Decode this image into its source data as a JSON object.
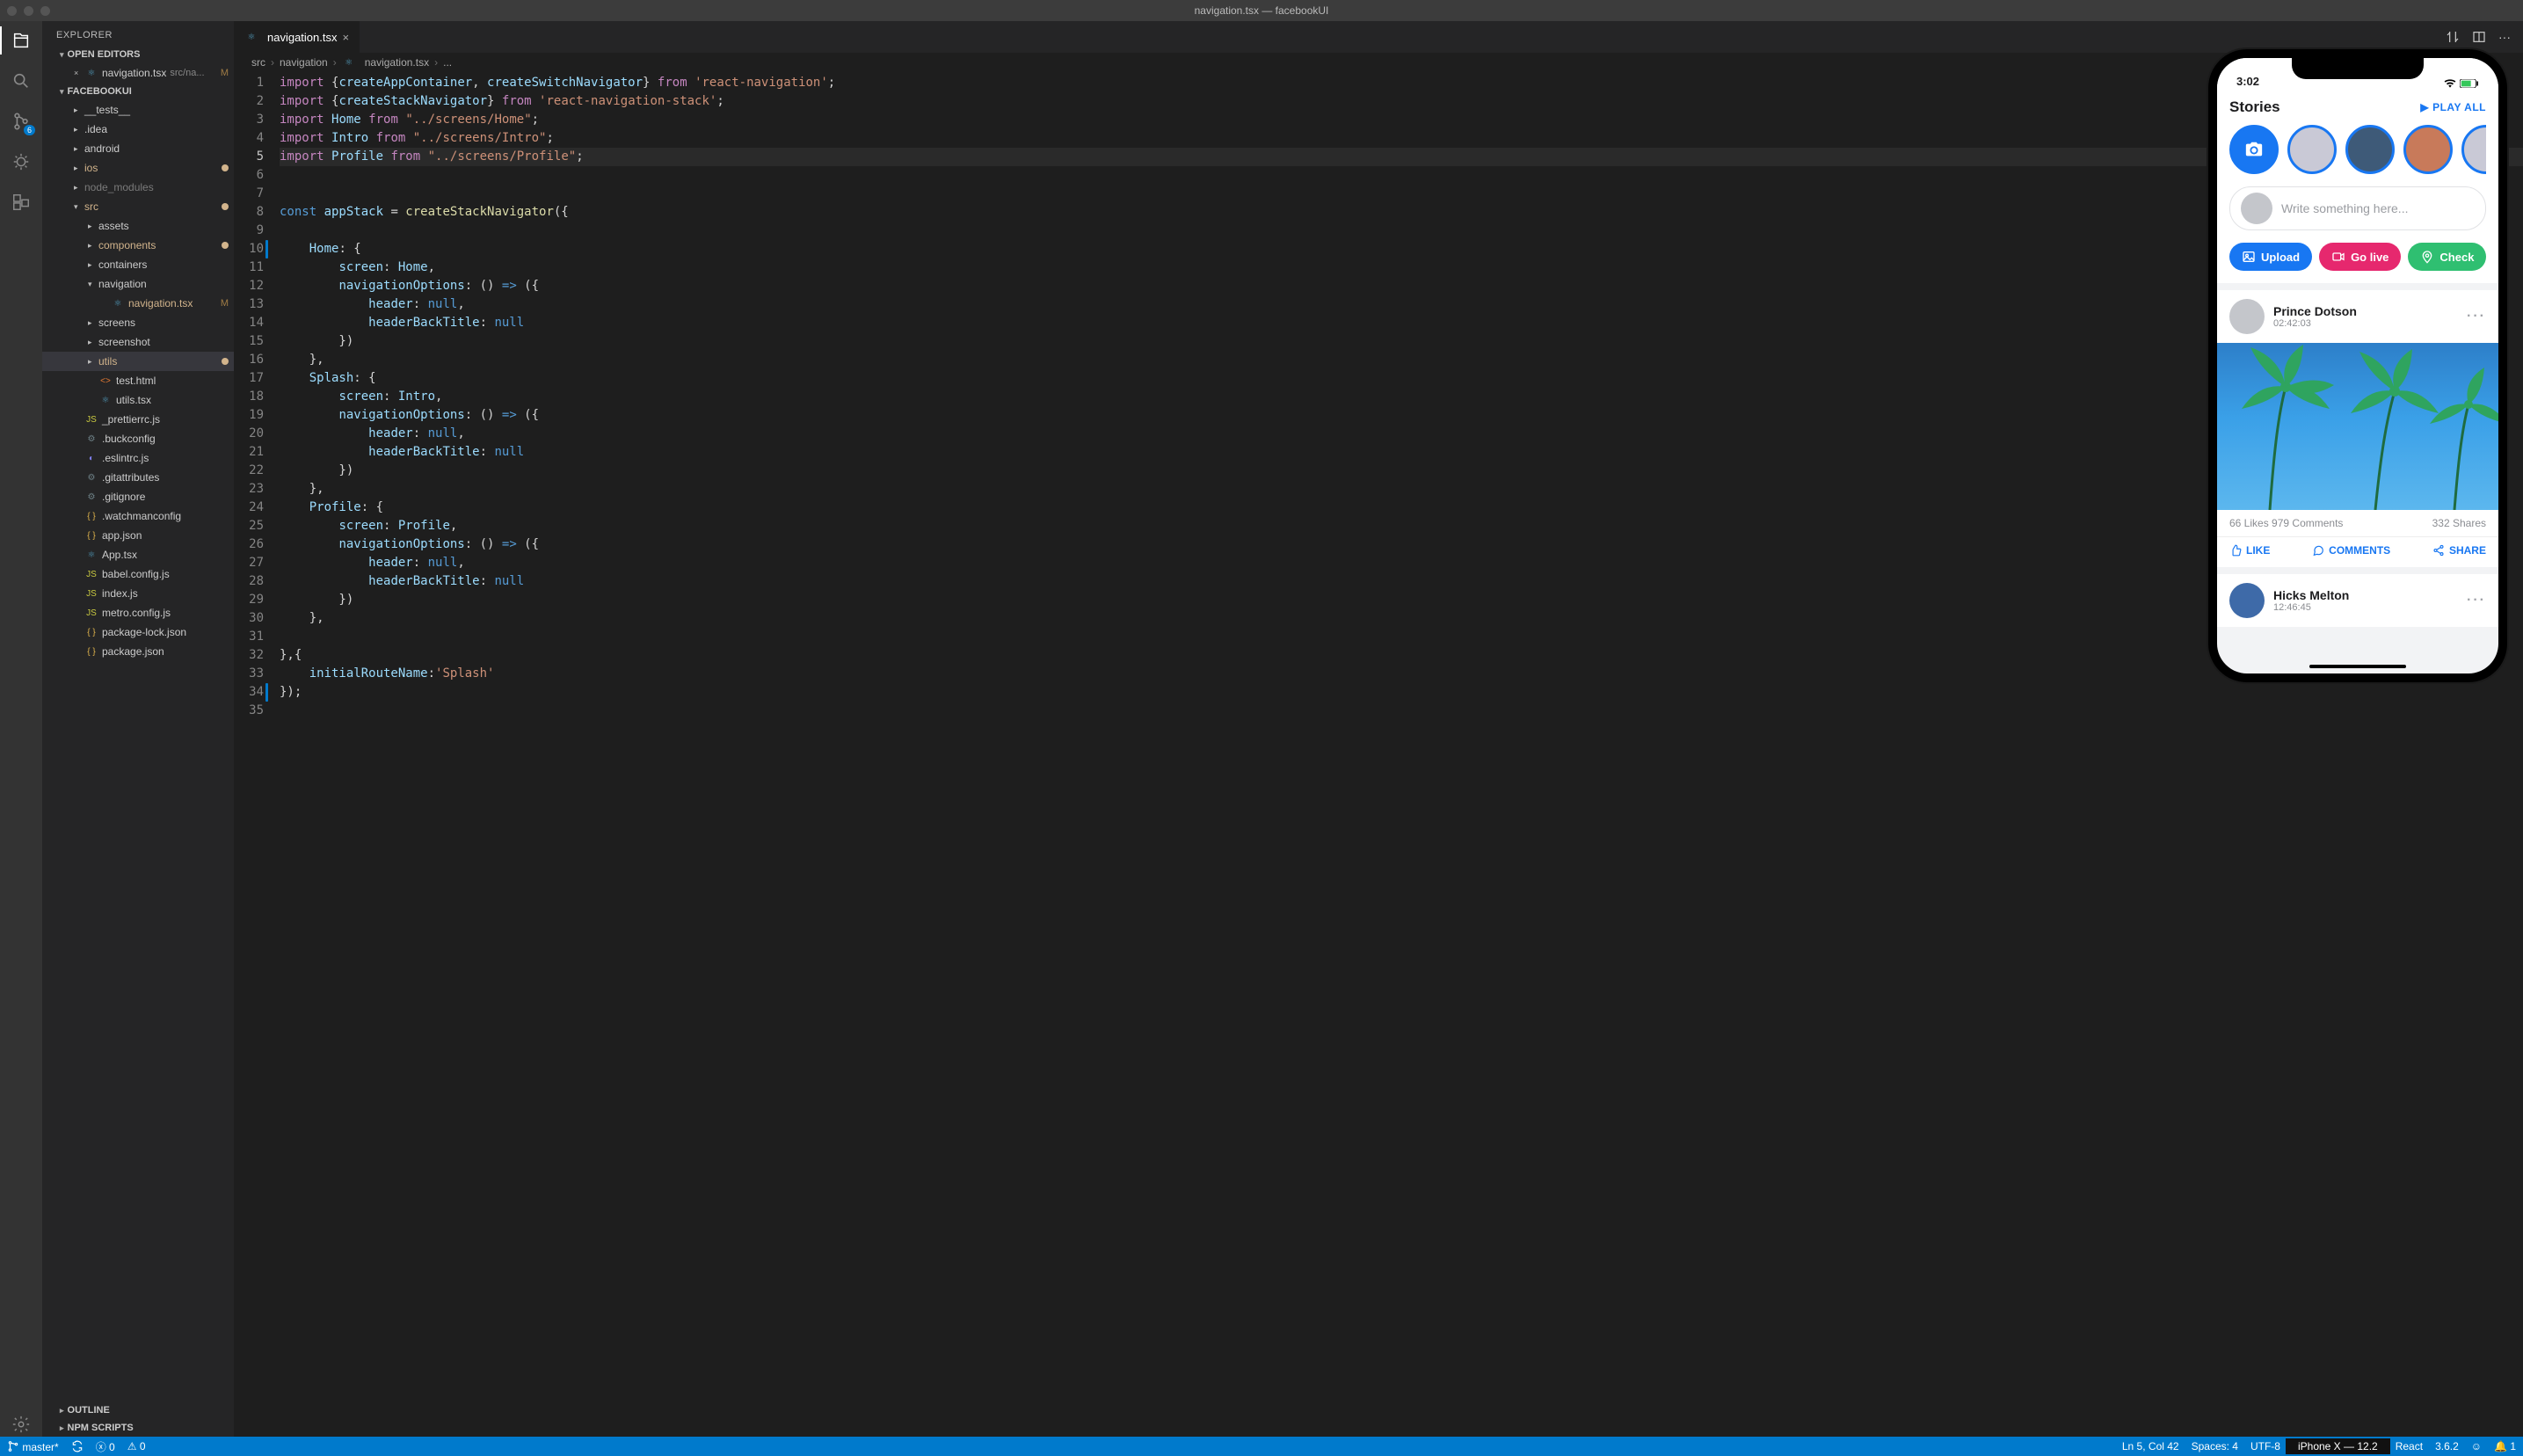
{
  "title": "navigation.tsx — facebookUI",
  "activitybar": {
    "scm_badge": "6"
  },
  "sidebar": {
    "header": "EXPLORER",
    "sections": {
      "open_editors": "OPEN EDITORS",
      "project": "FACEBOOKUI",
      "outline": "OUTLINE",
      "npm": "NPM SCRIPTS"
    },
    "open_editor": {
      "name": "navigation.tsx",
      "path": "src/na...",
      "status": "M"
    },
    "tree": [
      {
        "label": "__tests__",
        "depth": 2,
        "type": "folder"
      },
      {
        "label": ".idea",
        "depth": 2,
        "type": "folder"
      },
      {
        "label": "android",
        "depth": 2,
        "type": "folder"
      },
      {
        "label": "ios",
        "depth": 2,
        "type": "folder",
        "mod": true
      },
      {
        "label": "node_modules",
        "depth": 2,
        "type": "folder",
        "dim": true
      },
      {
        "label": "src",
        "depth": 2,
        "type": "folder",
        "open": true,
        "mod": true
      },
      {
        "label": "assets",
        "depth": 3,
        "type": "folder"
      },
      {
        "label": "components",
        "depth": 3,
        "type": "folder",
        "mod": true
      },
      {
        "label": "containers",
        "depth": 3,
        "type": "folder"
      },
      {
        "label": "navigation",
        "depth": 3,
        "type": "folder",
        "open": true,
        "selected": false
      },
      {
        "label": "navigation.tsx",
        "depth": 3,
        "type": "file",
        "icon": "ts",
        "status": "M",
        "indent4": true
      },
      {
        "label": "screens",
        "depth": 3,
        "type": "folder"
      },
      {
        "label": "screenshot",
        "depth": 3,
        "type": "folder"
      },
      {
        "label": "utils",
        "depth": 3,
        "type": "folder",
        "selected": true,
        "mod": true
      },
      {
        "label": "test.html",
        "depth": 3,
        "type": "file",
        "icon": "html"
      },
      {
        "label": "utils.tsx",
        "depth": 3,
        "type": "file",
        "icon": "ts"
      },
      {
        "label": "_prettierrc.js",
        "depth": 2,
        "type": "file",
        "icon": "js"
      },
      {
        "label": ".buckconfig",
        "depth": 2,
        "type": "file",
        "icon": "dot"
      },
      {
        "label": ".eslintrc.js",
        "depth": 2,
        "type": "file",
        "icon": "eslint"
      },
      {
        "label": ".gitattributes",
        "depth": 2,
        "type": "file",
        "icon": "dot"
      },
      {
        "label": ".gitignore",
        "depth": 2,
        "type": "file",
        "icon": "dot"
      },
      {
        "label": ".watchmanconfig",
        "depth": 2,
        "type": "file",
        "icon": "json"
      },
      {
        "label": "app.json",
        "depth": 2,
        "type": "file",
        "icon": "json"
      },
      {
        "label": "App.tsx",
        "depth": 2,
        "type": "file",
        "icon": "ts"
      },
      {
        "label": "babel.config.js",
        "depth": 2,
        "type": "file",
        "icon": "js"
      },
      {
        "label": "index.js",
        "depth": 2,
        "type": "file",
        "icon": "js"
      },
      {
        "label": "metro.config.js",
        "depth": 2,
        "type": "file",
        "icon": "js"
      },
      {
        "label": "package-lock.json",
        "depth": 2,
        "type": "file",
        "icon": "json"
      },
      {
        "label": "package.json",
        "depth": 2,
        "type": "file",
        "icon": "json"
      }
    ]
  },
  "tab": {
    "label": "navigation.tsx"
  },
  "breadcrumbs": [
    "src",
    "navigation",
    "navigation.tsx",
    "..."
  ],
  "code_lines": [
    {
      "n": 1,
      "tokens": [
        [
          "import ",
          "keyword"
        ],
        [
          "{",
          ""
        ],
        [
          "createAppContainer",
          "var"
        ],
        [
          ", ",
          ""
        ],
        [
          "createSwitchNavigator",
          "var"
        ],
        [
          "} ",
          ""
        ],
        [
          "from ",
          "keyword"
        ],
        [
          "'react-navigation'",
          "string"
        ],
        [
          ";",
          ""
        ]
      ]
    },
    {
      "n": 2,
      "tokens": [
        [
          "import ",
          "keyword"
        ],
        [
          "{",
          ""
        ],
        [
          "createStackNavigator",
          "var"
        ],
        [
          "} ",
          ""
        ],
        [
          "from ",
          "keyword"
        ],
        [
          "'react-navigation-stack'",
          "string"
        ],
        [
          ";",
          ""
        ]
      ]
    },
    {
      "n": 3,
      "tokens": [
        [
          "import ",
          "keyword"
        ],
        [
          "Home ",
          "var"
        ],
        [
          "from ",
          "keyword"
        ],
        [
          "\"../screens/Home\"",
          "string"
        ],
        [
          ";",
          ""
        ]
      ]
    },
    {
      "n": 4,
      "tokens": [
        [
          "import ",
          "keyword"
        ],
        [
          "Intro ",
          "var"
        ],
        [
          "from ",
          "keyword"
        ],
        [
          "\"../screens/Intro\"",
          "string"
        ],
        [
          ";",
          ""
        ]
      ]
    },
    {
      "n": 5,
      "hl": true,
      "tokens": [
        [
          "import ",
          "keyword"
        ],
        [
          "Profile ",
          "var"
        ],
        [
          "from ",
          "keyword"
        ],
        [
          "\"../screens/Profile\"",
          "string"
        ],
        [
          ";",
          ""
        ]
      ]
    },
    {
      "n": 6,
      "tokens": []
    },
    {
      "n": 7,
      "tokens": []
    },
    {
      "n": 8,
      "tokens": [
        [
          "const ",
          "const"
        ],
        [
          "appStack ",
          "var"
        ],
        [
          "= ",
          ""
        ],
        [
          "createStackNavigator",
          "func"
        ],
        [
          "({",
          ""
        ]
      ]
    },
    {
      "n": 9,
      "mark": true,
      "tokens": []
    },
    {
      "n": 10,
      "tokens": [
        [
          "    ",
          ""
        ],
        [
          "Home",
          "var"
        ],
        [
          ": {",
          ""
        ]
      ]
    },
    {
      "n": 11,
      "tokens": [
        [
          "        ",
          ""
        ],
        [
          "screen",
          "var"
        ],
        [
          ": ",
          ""
        ],
        [
          "Home",
          "var"
        ],
        [
          ",",
          ""
        ]
      ]
    },
    {
      "n": 12,
      "tokens": [
        [
          "        ",
          ""
        ],
        [
          "navigationOptions",
          "var"
        ],
        [
          ": () ",
          ""
        ],
        [
          "=>",
          "arrow"
        ],
        [
          " ({",
          ""
        ]
      ]
    },
    {
      "n": 13,
      "tokens": [
        [
          "            ",
          ""
        ],
        [
          "header",
          "var"
        ],
        [
          ": ",
          ""
        ],
        [
          "null",
          "const"
        ],
        [
          ",",
          ""
        ]
      ]
    },
    {
      "n": 14,
      "tokens": [
        [
          "            ",
          ""
        ],
        [
          "headerBackTitle",
          "var"
        ],
        [
          ": ",
          ""
        ],
        [
          "null",
          "const"
        ]
      ]
    },
    {
      "n": 15,
      "tokens": [
        [
          "        })",
          ""
        ]
      ]
    },
    {
      "n": 16,
      "tokens": [
        [
          "    },",
          ""
        ]
      ]
    },
    {
      "n": 17,
      "tokens": [
        [
          "    ",
          ""
        ],
        [
          "Splash",
          "var"
        ],
        [
          ": {",
          ""
        ]
      ]
    },
    {
      "n": 18,
      "tokens": [
        [
          "        ",
          ""
        ],
        [
          "screen",
          "var"
        ],
        [
          ": ",
          ""
        ],
        [
          "Intro",
          "var"
        ],
        [
          ",",
          ""
        ]
      ]
    },
    {
      "n": 19,
      "tokens": [
        [
          "        ",
          ""
        ],
        [
          "navigationOptions",
          "var"
        ],
        [
          ": () ",
          ""
        ],
        [
          "=>",
          "arrow"
        ],
        [
          " ({",
          ""
        ]
      ]
    },
    {
      "n": 20,
      "tokens": [
        [
          "            ",
          ""
        ],
        [
          "header",
          "var"
        ],
        [
          ": ",
          ""
        ],
        [
          "null",
          "const"
        ],
        [
          ",",
          ""
        ]
      ]
    },
    {
      "n": 21,
      "tokens": [
        [
          "            ",
          ""
        ],
        [
          "headerBackTitle",
          "var"
        ],
        [
          ": ",
          ""
        ],
        [
          "null",
          "const"
        ]
      ]
    },
    {
      "n": 22,
      "tokens": [
        [
          "        })",
          ""
        ]
      ]
    },
    {
      "n": 23,
      "tokens": [
        [
          "    },",
          ""
        ]
      ]
    },
    {
      "n": 24,
      "tokens": [
        [
          "    ",
          ""
        ],
        [
          "Profile",
          "var"
        ],
        [
          ": {",
          ""
        ]
      ]
    },
    {
      "n": 25,
      "tokens": [
        [
          "        ",
          ""
        ],
        [
          "screen",
          "var"
        ],
        [
          ": ",
          ""
        ],
        [
          "Profile",
          "var"
        ],
        [
          ",",
          ""
        ]
      ]
    },
    {
      "n": 26,
      "tokens": [
        [
          "        ",
          ""
        ],
        [
          "navigationOptions",
          "var"
        ],
        [
          ": () ",
          ""
        ],
        [
          "=>",
          "arrow"
        ],
        [
          " ({",
          ""
        ]
      ]
    },
    {
      "n": 27,
      "tokens": [
        [
          "            ",
          ""
        ],
        [
          "header",
          "var"
        ],
        [
          ": ",
          ""
        ],
        [
          "null",
          "const"
        ],
        [
          ",",
          ""
        ]
      ]
    },
    {
      "n": 28,
      "tokens": [
        [
          "            ",
          ""
        ],
        [
          "headerBackTitle",
          "var"
        ],
        [
          ": ",
          ""
        ],
        [
          "null",
          "const"
        ]
      ]
    },
    {
      "n": 29,
      "tokens": [
        [
          "        })",
          ""
        ]
      ]
    },
    {
      "n": 30,
      "tokens": [
        [
          "    },",
          ""
        ]
      ]
    },
    {
      "n": 31,
      "tokens": []
    },
    {
      "n": 32,
      "tokens": [
        [
          "},{",
          ""
        ]
      ]
    },
    {
      "n": 33,
      "mark": true,
      "tokens": [
        [
          "    ",
          ""
        ],
        [
          "initialRouteName",
          "var"
        ],
        [
          ":",
          ""
        ],
        [
          "'Splash'",
          "string"
        ]
      ]
    },
    {
      "n": 34,
      "tokens": [
        [
          "});",
          ""
        ]
      ]
    },
    {
      "n": 35,
      "tokens": []
    }
  ],
  "status": {
    "branch": "master*",
    "errors": "0",
    "warnings": "0",
    "ln_col": "Ln 5, Col 42",
    "spaces": "Spaces: 4",
    "encoding": "UTF-8",
    "react": "React",
    "version": "3.6.2",
    "bell": "1"
  },
  "simulator": {
    "label": "iPhone X — 12.2",
    "time": "3:02",
    "stories_title": "Stories",
    "play_all": "PLAY ALL",
    "compose_placeholder": "Write something here...",
    "actions": {
      "upload": "Upload",
      "golive": "Go live",
      "check": "Check"
    },
    "post1": {
      "name": "Prince Dotson",
      "time": "02:42:03",
      "likes": "66 Likes",
      "comments_count": "979 Comments",
      "shares": "332 Shares",
      "like_btn": "LIKE",
      "comments_btn": "COMMENTS",
      "share_btn": "SHARE"
    },
    "post2": {
      "name": "Hicks Melton",
      "time": "12:46:45"
    }
  }
}
